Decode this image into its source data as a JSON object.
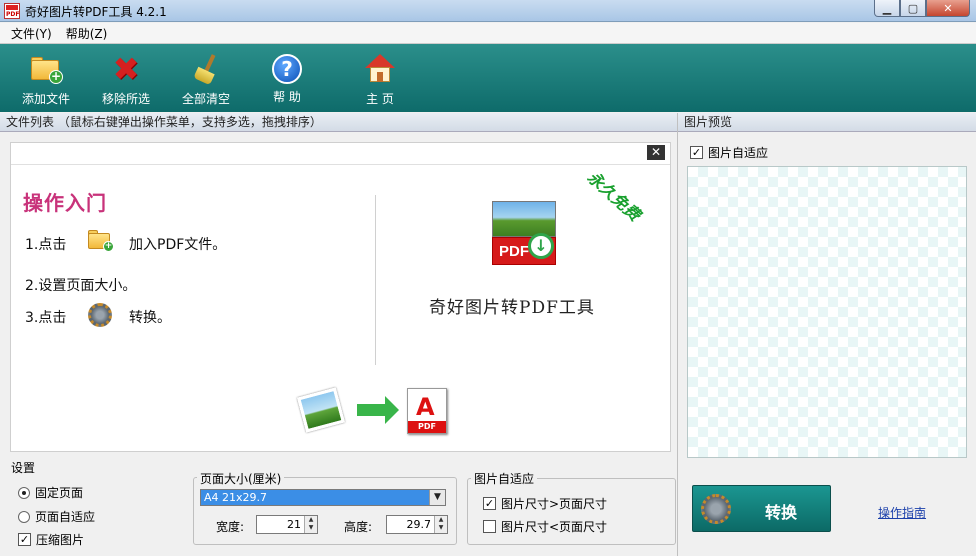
{
  "window": {
    "title": "奇好图片转PDF工具 4.2.1",
    "icon_label": "PDF",
    "minimize_symbol": "▁",
    "maximize_symbol": "▢",
    "close_symbol": "✕"
  },
  "menu": {
    "items": [
      "文件(Y)",
      "帮助(Z)"
    ]
  },
  "toolbar": {
    "add_files": "添加文件",
    "remove_selected": "移除所选",
    "clear_all": "全部清空",
    "help": "帮 助",
    "home": "主 页",
    "remove_symbol": "✖",
    "help_symbol": "?",
    "add_symbol": "+"
  },
  "file_list": {
    "header": "文件列表 （鼠标右键弹出操作菜单，支持多选，拖拽排序）",
    "close_symbol": "✕",
    "guide_title": "操作入门",
    "step1_prefix": "1.点击",
    "step1_suffix": "加入PDF文件。",
    "step2": "2.设置页面大小。",
    "step3_prefix": "3.点击",
    "step3_suffix": "转换。",
    "free_badge": "永久免费",
    "pdf_icon_text": "PDF",
    "pdf_icon_arrow": "↓",
    "product_name": "奇好图片转PDF工具",
    "doc_symbol": "A",
    "doc_tag": "PDF",
    "mini_plus": "+"
  },
  "preview": {
    "header": "图片预览",
    "fit_label": "图片自适应",
    "fit_checked": true
  },
  "settings": {
    "label": "设置",
    "fixed_page": "固定页面",
    "fixed_page_selected": true,
    "auto_page": "页面自适应",
    "auto_page_selected": false,
    "compress": "压缩图片",
    "compress_checked": true,
    "check_mark": "✓"
  },
  "page_size": {
    "title": "页面大小(厘米)",
    "selected": "A4          21x29.7",
    "dropdown_arrow": "▼",
    "width_label": "宽度:",
    "width_value": "21",
    "height_label": "高度:",
    "height_value": "29.7",
    "spin_up": "▲",
    "spin_down": "▼"
  },
  "image_fit": {
    "title": "图片自适应",
    "larger_label": "图片尺寸>页面尺寸",
    "larger_checked": true,
    "smaller_label": "图片尺寸<页面尺寸",
    "smaller_checked": false
  },
  "actions": {
    "convert": "转换",
    "guide_link": "操作指南"
  }
}
